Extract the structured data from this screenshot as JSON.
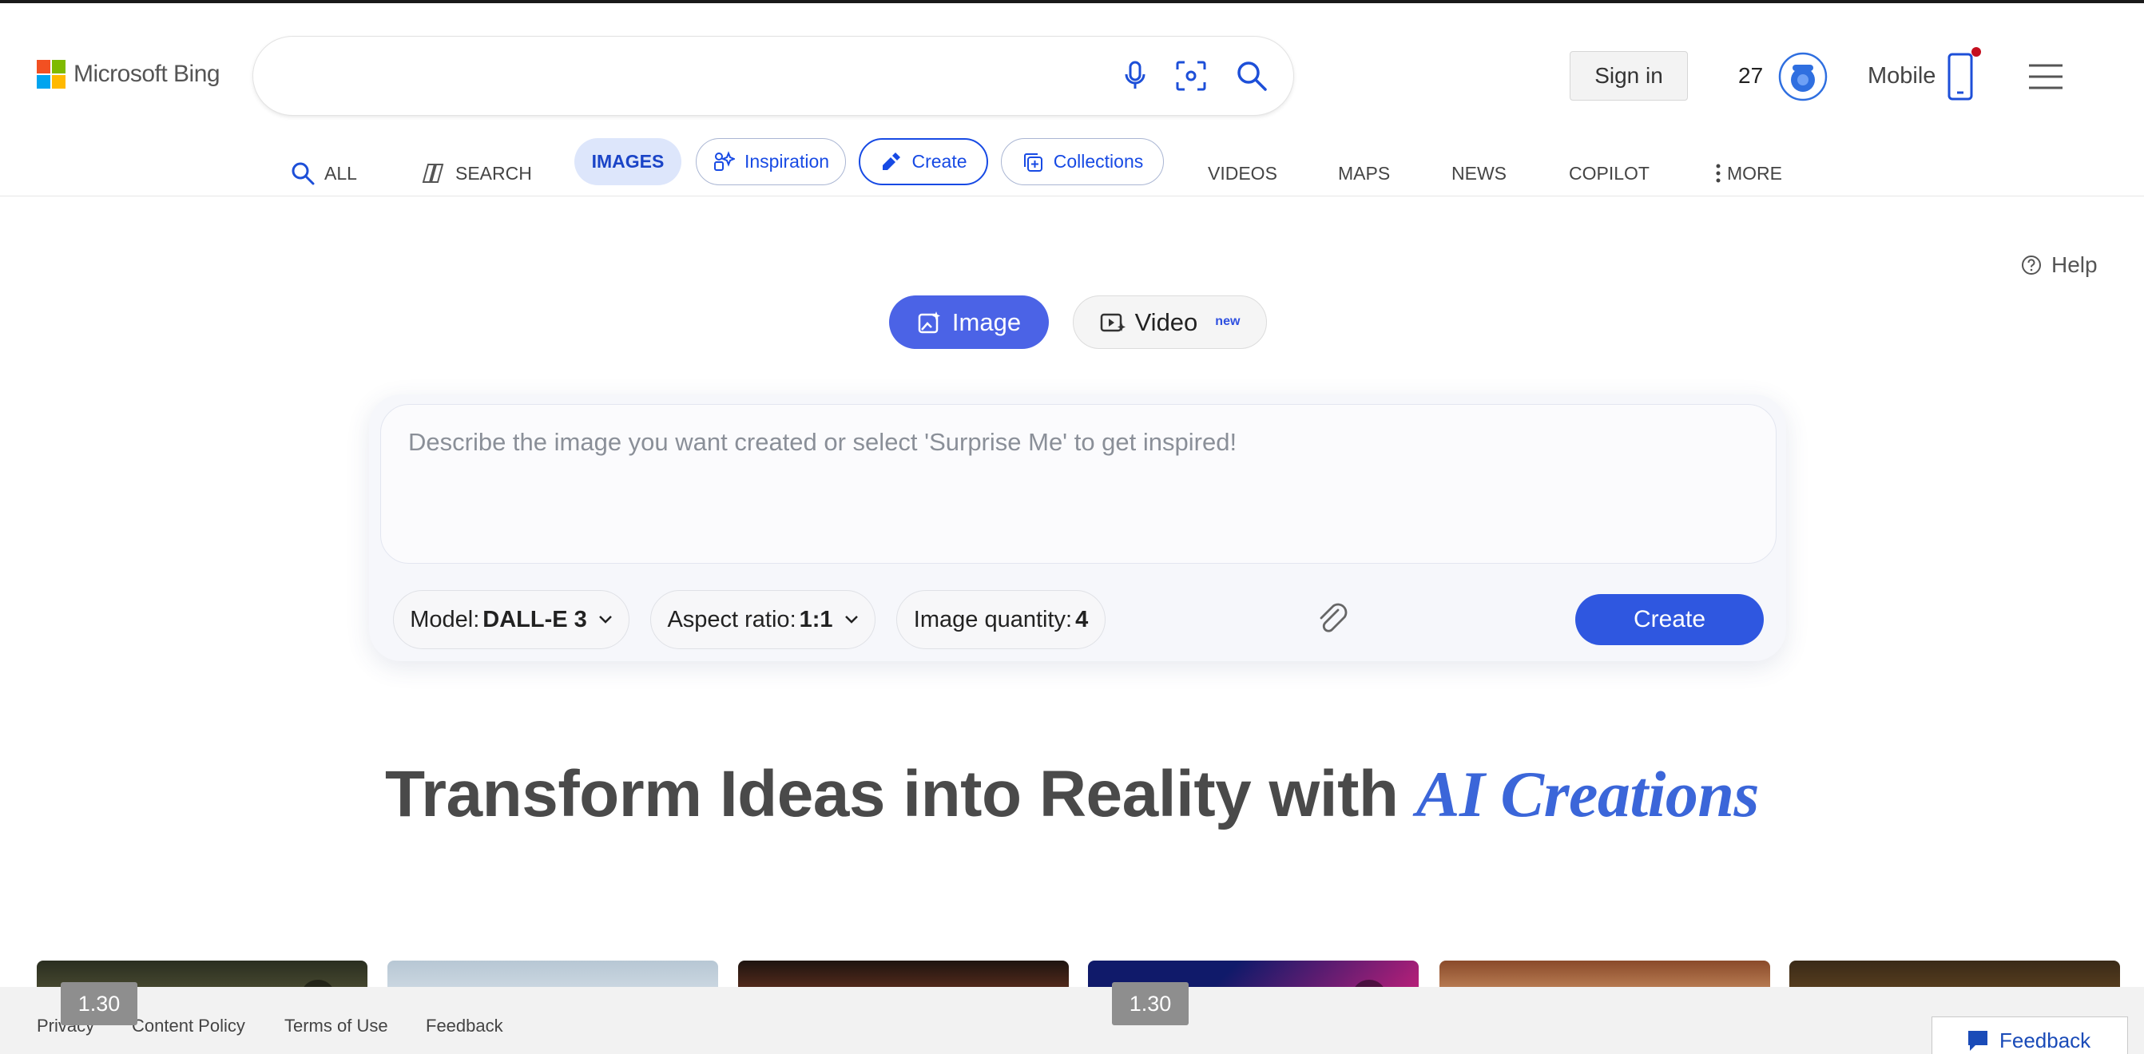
{
  "brand": {
    "logo_text": "Microsoft Bing",
    "logo_colors": [
      "#f25022",
      "#7fba00",
      "#00a4ef",
      "#ffb900"
    ]
  },
  "search": {
    "value": "",
    "placeholder": ""
  },
  "header": {
    "sign_in_label": "Sign in",
    "reward_points": "27",
    "mobile_label": "Mobile"
  },
  "tabs": {
    "all": "ALL",
    "search": "SEARCH",
    "images": "IMAGES",
    "inspiration": "Inspiration",
    "create": "Create",
    "collections": "Collections",
    "videos": "VIDEOS",
    "maps": "MAPS",
    "news": "NEWS",
    "copilot": "COPILOT",
    "more": "MORE"
  },
  "help_label": "Help",
  "mode": {
    "image_label": "Image",
    "video_label": "Video",
    "video_badge": "new",
    "selected": "Image"
  },
  "prompt": {
    "placeholder": "Describe the image you want created or select 'Surprise Me' to get inspired!",
    "value": ""
  },
  "options": {
    "model_label": "Model:",
    "model_value": "DALL-E 3",
    "aspect_label": "Aspect ratio:",
    "aspect_value": "1:1",
    "quantity_label": "Image quantity:",
    "quantity_value": "4"
  },
  "create_button_label": "Create",
  "headline": {
    "main": "Transform Ideas into Reality with ",
    "accent": "AI Creations"
  },
  "version_badges": [
    "1.30",
    "1.30"
  ],
  "footer": {
    "links": [
      "Privacy",
      "Content Policy",
      "Terms of Use",
      "Feedback"
    ],
    "feedback_button": "Feedback"
  },
  "colors": {
    "accent_blue": "#174ae4",
    "mode_active": "#4b63e6",
    "create_button": "#2f57e0",
    "headline_accent": "#3b66d9"
  }
}
